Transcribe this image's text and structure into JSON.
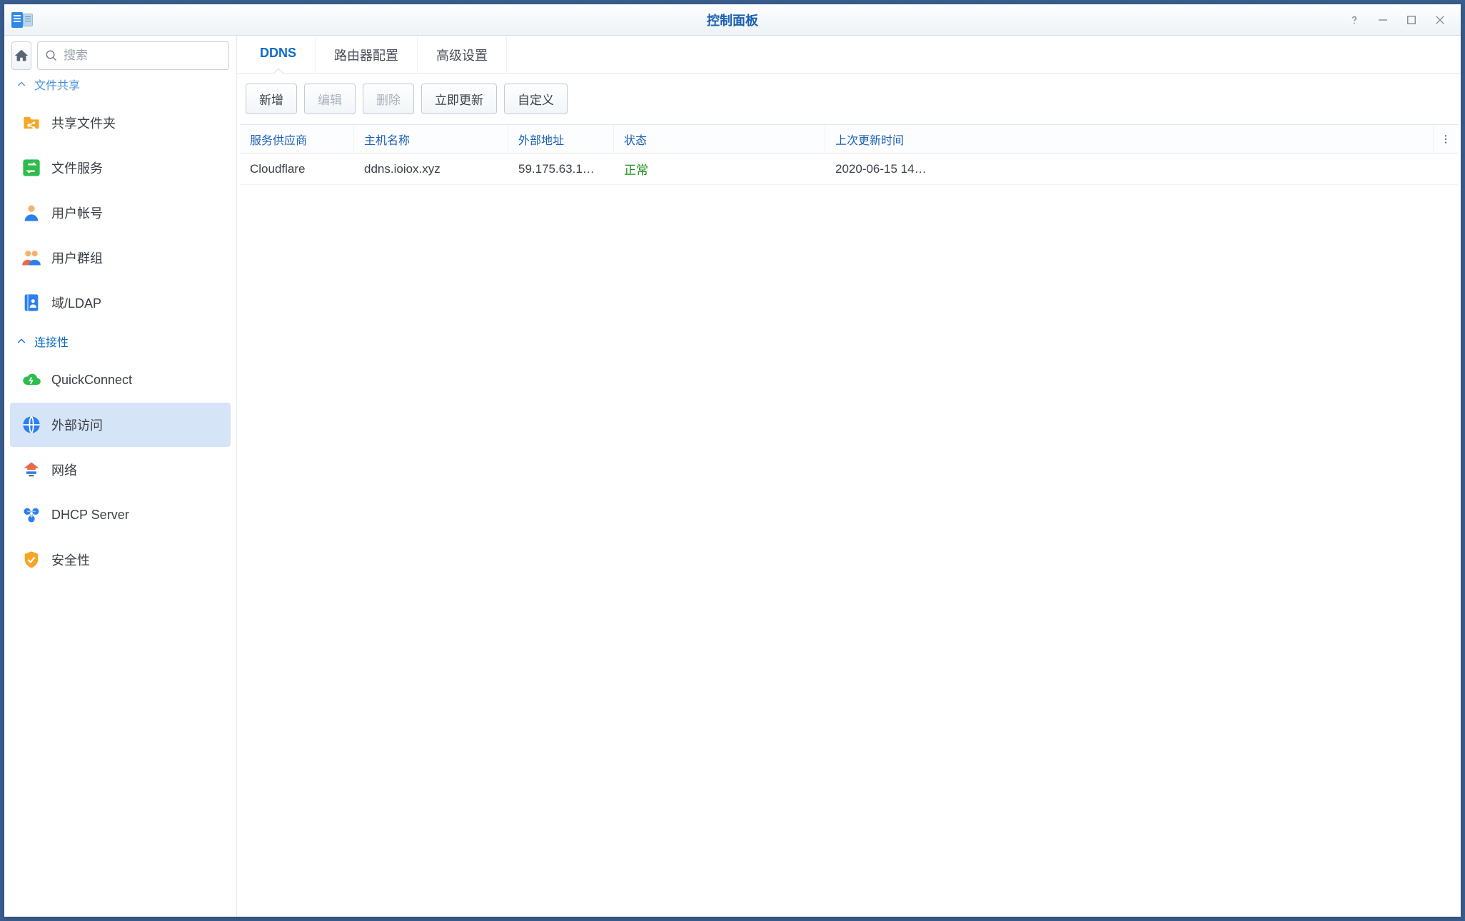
{
  "window": {
    "title": "控制面板"
  },
  "search": {
    "placeholder": "搜索"
  },
  "sidebar": {
    "section_file_sharing": "文件共享",
    "section_connectivity": "连接性",
    "items": {
      "shared_folder": "共享文件夹",
      "file_services": "文件服务",
      "user": "用户帐号",
      "group": "用户群组",
      "domain_ldap": "域/LDAP",
      "quickconnect": "QuickConnect",
      "external_access": "外部访问",
      "network": "网络",
      "dhcp": "DHCP Server",
      "security": "安全性"
    }
  },
  "tabs": {
    "ddns": "DDNS",
    "router": "路由器配置",
    "advanced": "高级设置"
  },
  "toolbar": {
    "add": "新增",
    "edit": "编辑",
    "delete": "删除",
    "update_now": "立即更新",
    "custom": "自定义"
  },
  "table": {
    "headers": {
      "provider": "服务供应商",
      "hostname": "主机名称",
      "external_ip": "外部地址",
      "status": "状态",
      "last_update": "上次更新时间"
    },
    "rows": [
      {
        "provider": "Cloudflare",
        "hostname": "ddns.ioiox.xyz",
        "external_ip": "59.175.63.1…",
        "status": "正常",
        "last_update": "2020-06-15 14…"
      }
    ]
  }
}
